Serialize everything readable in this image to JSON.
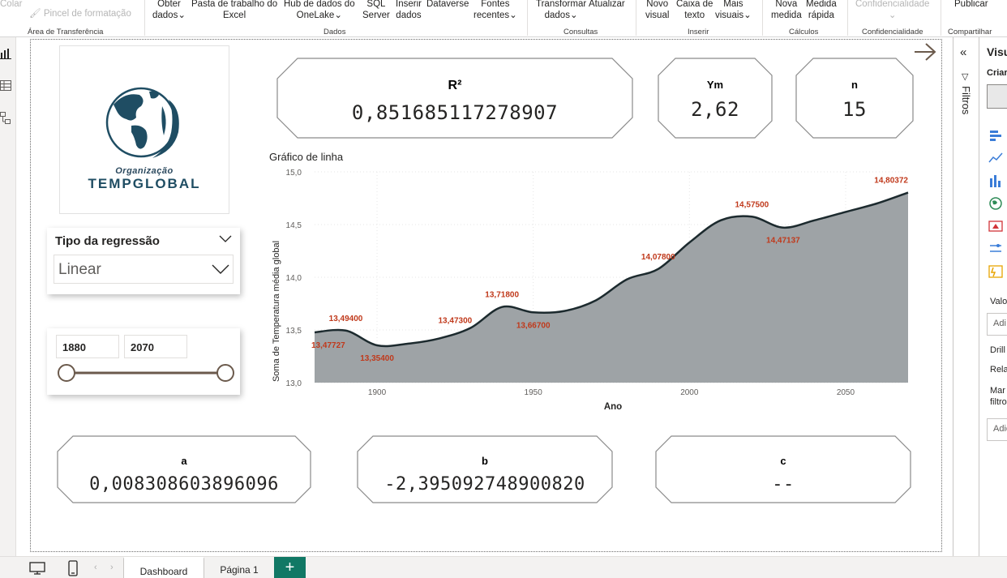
{
  "ribbon": {
    "colar": "Colar",
    "pincel": "Pincel de formatação",
    "area_transferencia": "Área de Transferência",
    "obter_dados_1": "Obter",
    "obter_dados_2": "dados",
    "pasta_1": "Pasta de trabalho do",
    "pasta_2": "Excel",
    "hub_1": "Hub de dados do",
    "hub_2": "OneLake",
    "sql_1": "SQL",
    "sql_2": "Server",
    "inserir_dados_1": "Inserir",
    "inserir_dados_2": "dados",
    "dataverse": "Dataverse",
    "fontes_1": "Fontes",
    "fontes_2": "recentes",
    "dados_group": "Dados",
    "transformar_1": "Transformar",
    "transformar_2": "dados",
    "atualizar": "Atualizar",
    "consultas_group": "Consultas",
    "novo_visual_1": "Novo",
    "novo_visual_2": "visual",
    "caixa_1": "Caixa de",
    "caixa_2": "texto",
    "mais_1": "Mais",
    "mais_2": "visuais",
    "inserir_group": "Inserir",
    "nova_medida_1": "Nova",
    "nova_medida_2": "medida",
    "medida_rapida_1": "Medida",
    "medida_rapida_2": "rápida",
    "calculos_group": "Cálculos",
    "confidencialidade_btn": "Confidencialidade",
    "confidencialidade_group": "Confidencialidade",
    "publicar": "Publicar",
    "compartilhar_group": "Compartilhar"
  },
  "panes": {
    "filtros": "Filtros",
    "viz_title": "Visu",
    "viz_sub": "Criar",
    "valores": "Valo",
    "adic1": "Adi",
    "drill": "Drill",
    "rela": "Rela",
    "manter_1": "Mar",
    "manter_2": "filtro",
    "adic2": "Adic"
  },
  "tabs": {
    "dashboard": "Dashboard",
    "pagina1": "Página 1",
    "add": "+"
  },
  "logo": {
    "org": "Organização",
    "brand": "TEMPGLOBAL"
  },
  "cards": {
    "r2_title": "R²",
    "r2_value": "0,85168511727890​7",
    "ym_title": "Ym",
    "ym_value": "2,62",
    "n_title": "n",
    "n_value": "15",
    "a_title": "a",
    "a_value": "0,008308603896096",
    "b_title": "b",
    "b_value": "-2,395092748900820",
    "c_title": "c",
    "c_value": "--"
  },
  "slicer_tipo": {
    "title": "Tipo da regressão",
    "selected": "Linear"
  },
  "slicer_ano": {
    "from": "1880",
    "to": "2070"
  },
  "colors": {
    "area_fill": "#9ea3a6",
    "line": "#1c2a2e",
    "label": "#c0391b",
    "slider": "#6b5a4c",
    "tab_add": "#117865"
  },
  "chart_data": {
    "type": "area",
    "title": "Gráfico de linha",
    "xlabel": "Ano",
    "ylabel": "Soma de Temperatura média global",
    "xlim": [
      1880,
      2070
    ],
    "ylim": [
      13.0,
      15.0
    ],
    "xticks": [
      1900,
      1950,
      2000,
      2050
    ],
    "yticks": [
      "13,0",
      "13,5",
      "14,0",
      "14,5",
      "15,0"
    ],
    "yticks_values": [
      13.0,
      13.5,
      14.0,
      14.5,
      15.0
    ],
    "grid": true,
    "x": [
      1880,
      1890,
      1900,
      1910,
      1920,
      1930,
      1940,
      1950,
      1960,
      1970,
      1980,
      1990,
      2000,
      2010,
      2020,
      2030,
      2040,
      2050,
      2060,
      2070
    ],
    "y": [
      13.477,
      13.494,
      13.354,
      13.37,
      13.42,
      13.52,
      13.718,
      13.667,
      13.68,
      13.78,
      13.98,
      14.078,
      14.33,
      14.54,
      14.575,
      14.471,
      14.54,
      14.62,
      14.7,
      14.8037
    ],
    "labels": [
      {
        "x": 1880,
        "y": 13.47727,
        "text": "13,47727",
        "pos": "below"
      },
      {
        "x": 1890,
        "y": 13.494,
        "text": "13,49400",
        "pos": "above"
      },
      {
        "x": 1900,
        "y": 13.354,
        "text": "13,35400",
        "pos": "below"
      },
      {
        "x": 1925,
        "y": 13.473,
        "text": "13,47300",
        "pos": "above"
      },
      {
        "x": 1940,
        "y": 13.718,
        "text": "13,71800",
        "pos": "above"
      },
      {
        "x": 1950,
        "y": 13.667,
        "text": "13,66700",
        "pos": "below"
      },
      {
        "x": 1990,
        "y": 14.078,
        "text": "14,07800",
        "pos": "above"
      },
      {
        "x": 2020,
        "y": 14.575,
        "text": "14,57500",
        "pos": "above"
      },
      {
        "x": 2030,
        "y": 14.47137,
        "text": "14,47137",
        "pos": "below"
      },
      {
        "x": 2070,
        "y": 14.80372,
        "text": "14,80372",
        "pos": "above"
      }
    ]
  }
}
